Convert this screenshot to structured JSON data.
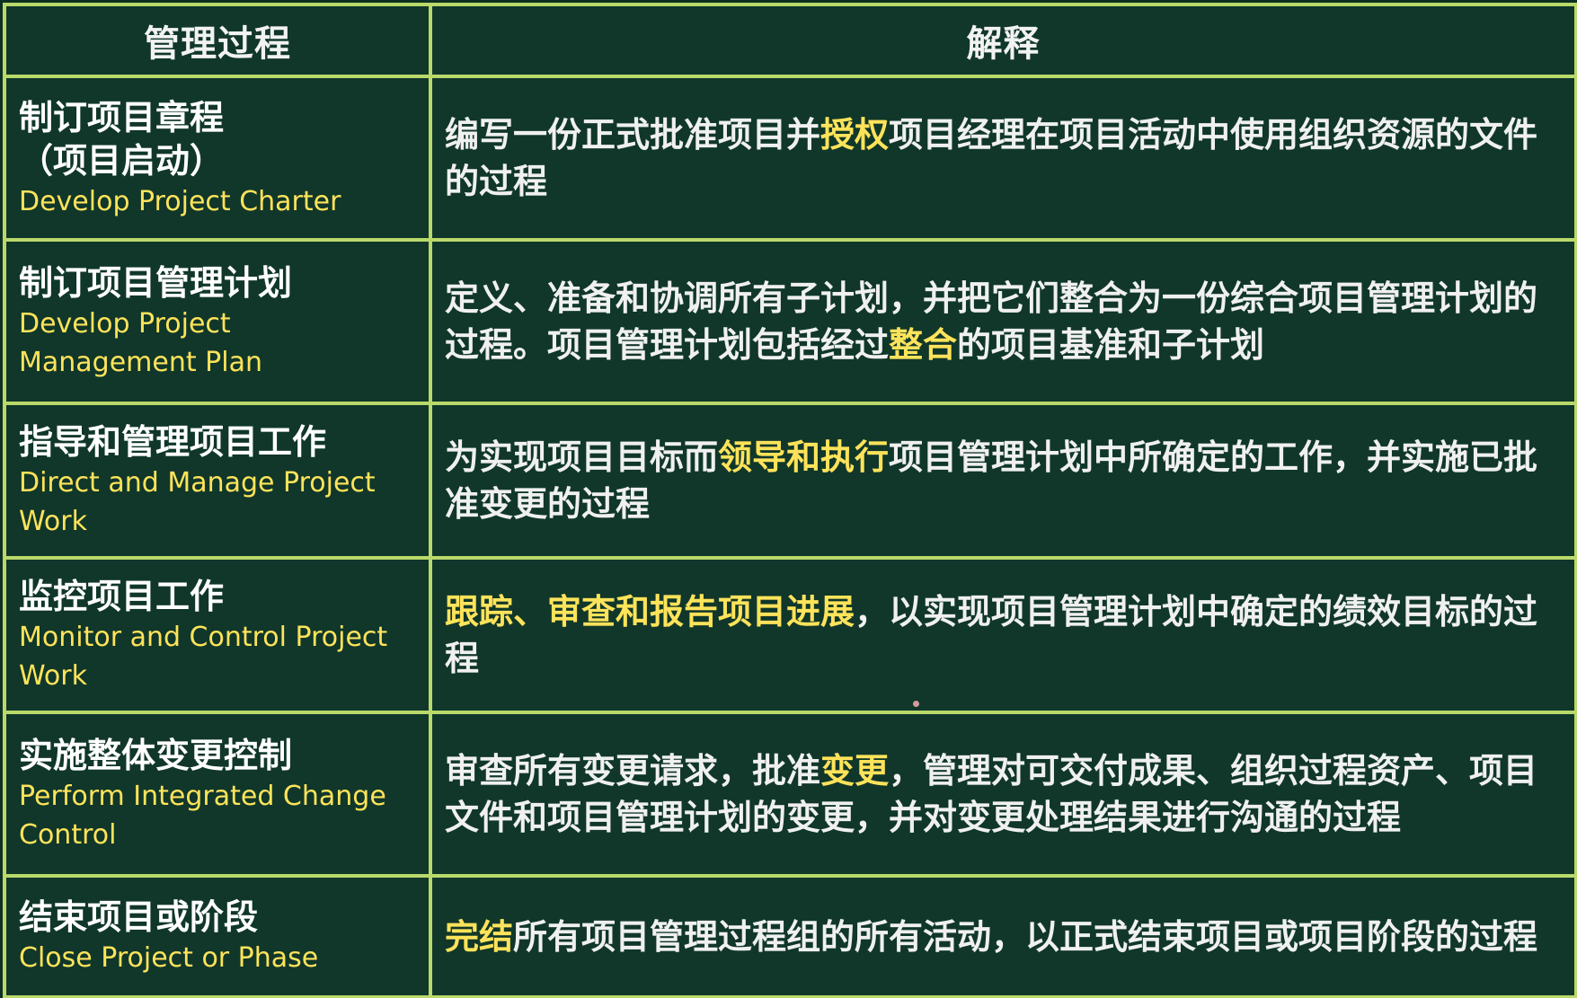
{
  "header": {
    "col_process": "管理过程",
    "col_explanation": "解释"
  },
  "rows": [
    {
      "name_cn": "制订项目章程",
      "name_cn_2": "（项目启动）",
      "name_en": "Develop Project  Charter",
      "desc": [
        {
          "text": "编写一份正式批准项目并",
          "hl": false
        },
        {
          "text": "授权",
          "hl": true
        },
        {
          "text": "项目经理在项目活动中使用组织资源的文件的过程",
          "hl": false
        }
      ]
    },
    {
      "name_cn": "制订项目管理计划",
      "name_en": "Develop Project",
      "name_en_2": "Management Plan",
      "desc": [
        {
          "text": "定义、准备和协调所有子计划，并把它们整合为一份综合项目管理计划的过程。项目管理计划包括经过",
          "hl": false
        },
        {
          "text": "整合",
          "hl": true
        },
        {
          "text": "的项目基准和子计划",
          "hl": false
        }
      ]
    },
    {
      "name_cn": "指导和管理项目工作",
      "name_en": "Direct and Manage Project",
      "name_en_2": "Work",
      "desc": [
        {
          "text": "为实现项目目标而",
          "hl": false
        },
        {
          "text": "领导和执行",
          "hl": true
        },
        {
          "text": "项目管理计划中所确定的工作，并实施已批准变更的过程",
          "hl": false
        }
      ]
    },
    {
      "name_cn": "监控项目工作",
      "name_en": "Monitor and Control Project",
      "name_en_2": "Work",
      "desc": [
        {
          "text": "跟踪、审查和报告项目进展",
          "hl": true
        },
        {
          "text": "，以实现项目管理计划中确定的绩效目标的过程",
          "hl": false
        }
      ]
    },
    {
      "name_cn": "实施整体变更控制",
      "name_en": "Perform  Integrated Change",
      "name_en_2": "Control",
      "desc": [
        {
          "text": "审查所有变更请求，批准",
          "hl": false
        },
        {
          "text": "变更",
          "hl": true
        },
        {
          "text": "，管理对可交付成果、组织过程资产、项目文件和项目管理计划的变更，并对变更处理结果进行沟通的过程",
          "hl": false
        }
      ]
    },
    {
      "name_cn": "结束项目或阶段",
      "name_en": "Close Project  or Phase",
      "desc": [
        {
          "text": "完结",
          "hl": true
        },
        {
          "text": "所有项目管理过程组的所有活动，以正式结束项目或项目阶段的过程",
          "hl": false
        }
      ]
    }
  ],
  "colors": {
    "background": "#10372a",
    "border": "#b9d96a",
    "highlight": "#ffe35a",
    "text": "#f0f0f0"
  }
}
